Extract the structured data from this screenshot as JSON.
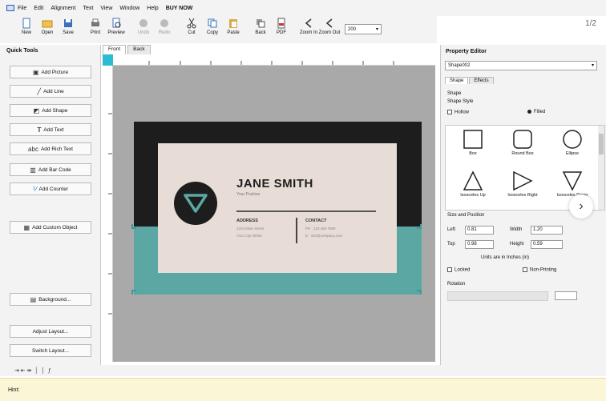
{
  "menu": [
    "File",
    "Edit",
    "Alignment",
    "Text",
    "View",
    "Window",
    "Help",
    "BUY NOW"
  ],
  "pager": "1/2",
  "toolbar": {
    "buttons": [
      "New",
      "Open",
      "Save",
      "Print",
      "Preview",
      "Undo",
      "Redo",
      "Cut",
      "Copy",
      "Paste",
      "Back",
      "PDF",
      "Zoom In",
      "Zoom Out"
    ],
    "zoom_value": "200"
  },
  "quick_tools": {
    "title": "Quick Tools",
    "buttons": [
      "Add Picture",
      "Add Line",
      "Add Shape",
      "Add Text",
      "Add Rich Text",
      "Add Bar Code",
      "Add Counter",
      "Add Custom Object",
      "Background...",
      "Adjust Layout...",
      "Switch Layout..."
    ]
  },
  "canvas_tabs": [
    "Front",
    "Back"
  ],
  "card": {
    "name": "JANE SMITH",
    "role": "Your Position",
    "address_title": "ADDRESS",
    "address_lines": [
      "1234 Main Street",
      "Your City 00000"
    ],
    "contact_title": "CONTACT",
    "contact_lines": [
      "PH : 123 456 7890",
      "E : info@company.com"
    ],
    "colors": {
      "black": "#1d1d1d",
      "teal": "#5aa7a3",
      "face": "#e7dcd6"
    }
  },
  "property_editor": {
    "title": "Property Editor",
    "selected": "Shape002",
    "tabs": [
      "Shape",
      "Effects"
    ],
    "shape_label": "Shape",
    "style_label": "Shape Style",
    "hollow": "Hollow",
    "filled": "Filled",
    "shapes": [
      "Box",
      "Round Box",
      "Ellipse",
      "Isosceles Up",
      "Isosceles Right",
      "Isosceles Down"
    ],
    "size_pos_title": "Size and Position",
    "left_label": "Left",
    "left_value": "0.81",
    "width_label": "Width",
    "width_value": "1.20",
    "top_label": "Top",
    "top_value": "0.98",
    "height_label": "Height",
    "height_value": "0.59",
    "units": "Units are in Inches (in)",
    "locked": "Locked",
    "non_printing": "Non-Printing",
    "rotation": "Rotation"
  },
  "hint_label": "Hint:"
}
